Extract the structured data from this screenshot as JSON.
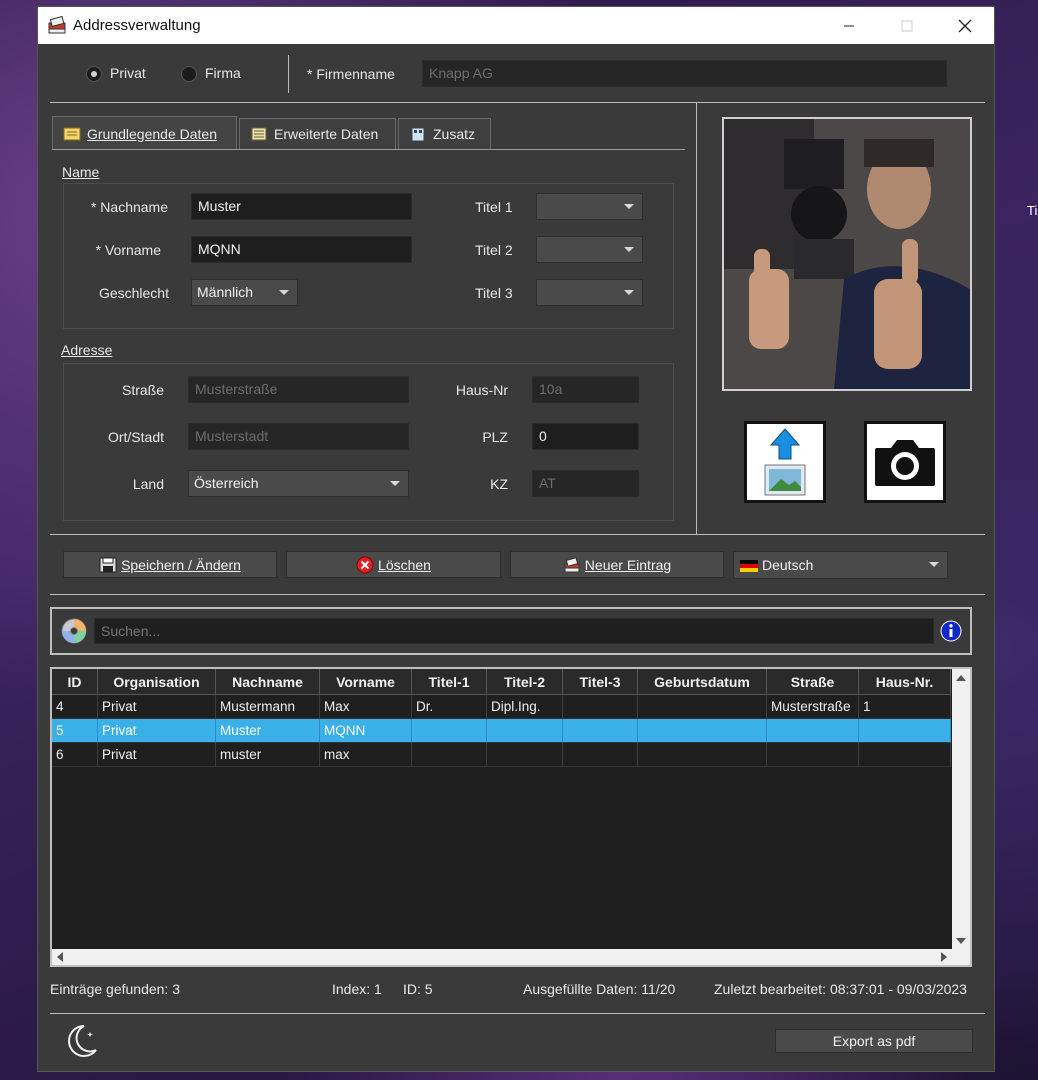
{
  "window": {
    "title": "Addressverwaltung"
  },
  "background_text": "Ti",
  "type_select": {
    "privat": "Privat",
    "firma": "Firma",
    "selected": "Privat"
  },
  "firmenname": {
    "label": "* Firmenname",
    "placeholder": "Knapp AG"
  },
  "tabs": [
    {
      "label": "Grundlegende Daten",
      "icon": "card-icon",
      "active": true
    },
    {
      "label": "Erweiterte Daten",
      "icon": "list-icon",
      "active": false
    },
    {
      "label": "Zusatz",
      "icon": "building-icon",
      "active": false
    }
  ],
  "name_section": {
    "title": "Name",
    "nachname_label": "* Nachname",
    "nachname_value": "Muster",
    "vorname_label": "* Vorname",
    "vorname_value": "MQNN",
    "geschlecht_label": "Geschlecht",
    "geschlecht_value": "Männlich",
    "titel1_label": "Titel 1",
    "titel2_label": "Titel 2",
    "titel3_label": "Titel 3"
  },
  "address_section": {
    "title": "Adresse",
    "strasse_label": "Straße",
    "strasse_placeholder": "Musterstraße",
    "hausnr_label": "Haus-Nr",
    "hausnr_placeholder": "10a",
    "ort_label": "Ort/Stadt",
    "ort_placeholder": "Musterstadt",
    "plz_label": "PLZ",
    "plz_value": "0",
    "land_label": "Land",
    "land_value": "Österreich",
    "kz_label": "KZ",
    "kz_placeholder": "AT"
  },
  "actions": {
    "save": "Speichern / Ändern",
    "delete": "Löschen",
    "new": "Neuer Eintrag",
    "language": "Deutsch"
  },
  "search": {
    "placeholder": "Suchen..."
  },
  "table": {
    "columns": [
      "ID",
      "Organisation",
      "Nachname",
      "Vorname",
      "Titel-1",
      "Titel-2",
      "Titel-3",
      "Geburtsdatum",
      "Straße",
      "Haus-Nr."
    ],
    "rows": [
      [
        "4",
        "Privat",
        "Mustermann",
        "Max",
        "Dr.",
        "Dipl.Ing.",
        "",
        "",
        "Musterstraße",
        "1"
      ],
      [
        "5",
        "Privat",
        "Muster",
        "MQNN",
        "",
        "",
        "",
        "",
        "",
        ""
      ],
      [
        "6",
        "Privat",
        "muster",
        "max",
        "",
        "",
        "",
        "",
        "",
        ""
      ]
    ],
    "selected_row": 1
  },
  "status": {
    "found": "Einträge gefunden: 3",
    "index": "Index: 1",
    "id": "ID: 5",
    "filled": "Ausgefüllte Daten: 11/20",
    "last_edit": "Zuletzt bearbeitet: 08:37:01 - 09/03/2023"
  },
  "footer": {
    "export": "Export as pdf"
  },
  "colors": {
    "selection": "#3ab0e8",
    "window_bg": "#3a3a3a",
    "field_bg": "#1e1e1e"
  }
}
